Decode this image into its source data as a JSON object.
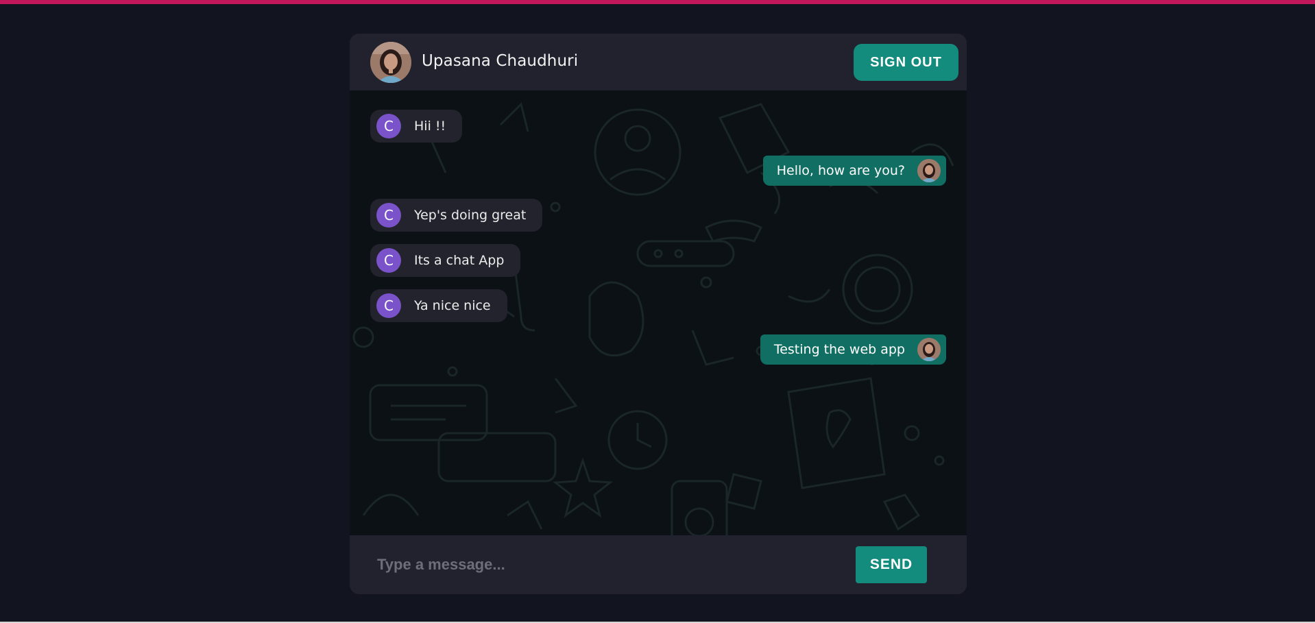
{
  "header": {
    "user_name": "Upasana Chaudhuri",
    "avatar_icon": "user-photo-avatar",
    "signout_label": "SIGN OUT"
  },
  "messages": [
    {
      "side": "in",
      "initial": "C",
      "text": "Hii !!"
    },
    {
      "side": "out",
      "text": "Hello, how are you?"
    },
    {
      "side": "in",
      "initial": "C",
      "text": "Yep's doing great"
    },
    {
      "side": "in",
      "initial": "C",
      "text": "Its a chat App"
    },
    {
      "side": "in",
      "initial": "C",
      "text": "Ya nice nice"
    },
    {
      "side": "out",
      "text": "Testing the web app"
    }
  ],
  "composer": {
    "placeholder": "Type a message...",
    "value": "",
    "send_label": "SEND"
  },
  "colors": {
    "accent": "#138c7e",
    "outgoing_bubble": "#116e62",
    "incoming_bubble": "#22232c",
    "initial_badge": "#7a52c9",
    "top_bar": "#c2185b",
    "page_background": "#121420"
  }
}
